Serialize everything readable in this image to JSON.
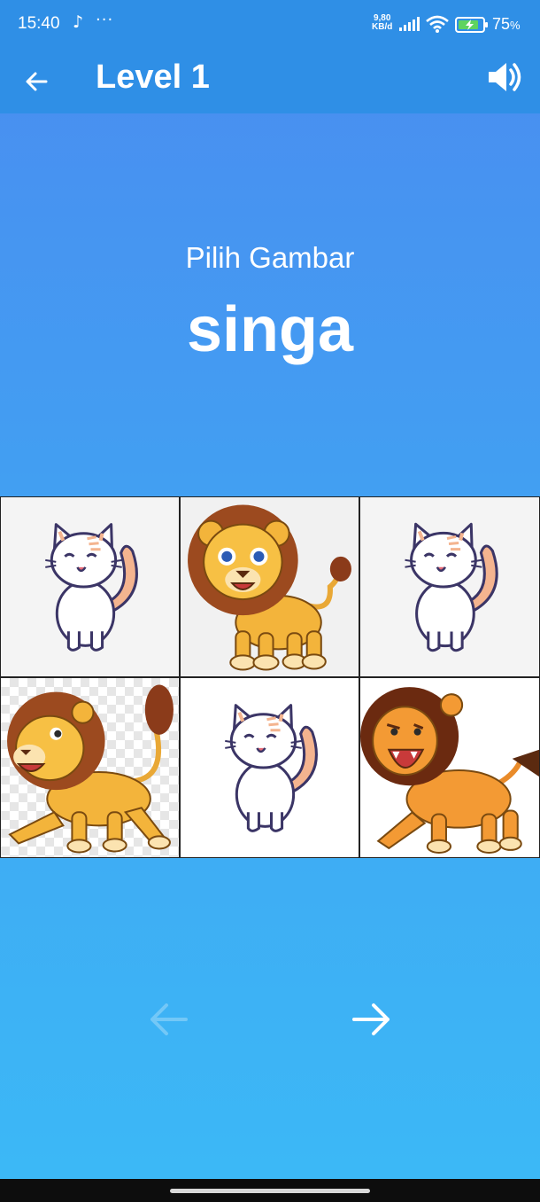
{
  "status": {
    "time": "15:40",
    "speed_top": "9,80",
    "speed_bottom": "KB/d",
    "battery": "75",
    "battery_unit": "%"
  },
  "header": {
    "title": "Level 1",
    "back_icon": "arrow-left-icon",
    "sound_icon": "speaker-icon"
  },
  "question": {
    "prompt": "Pilih Gambar",
    "word": "singa"
  },
  "tiles": [
    {
      "animal": "cat",
      "icon": "cat-image"
    },
    {
      "animal": "lion",
      "icon": "lion-image"
    },
    {
      "animal": "cat",
      "icon": "cat-image"
    },
    {
      "animal": "lion",
      "icon": "lion-image"
    },
    {
      "animal": "cat",
      "icon": "cat-image"
    },
    {
      "animal": "lion",
      "icon": "lion-image"
    }
  ],
  "navigation": {
    "prev_icon": "arrow-left-icon",
    "next_icon": "arrow-right-icon"
  },
  "colors": {
    "app_bar": "#2f8fe6",
    "background_top": "#4a8cf0",
    "background_bottom": "#3cb9f6"
  }
}
